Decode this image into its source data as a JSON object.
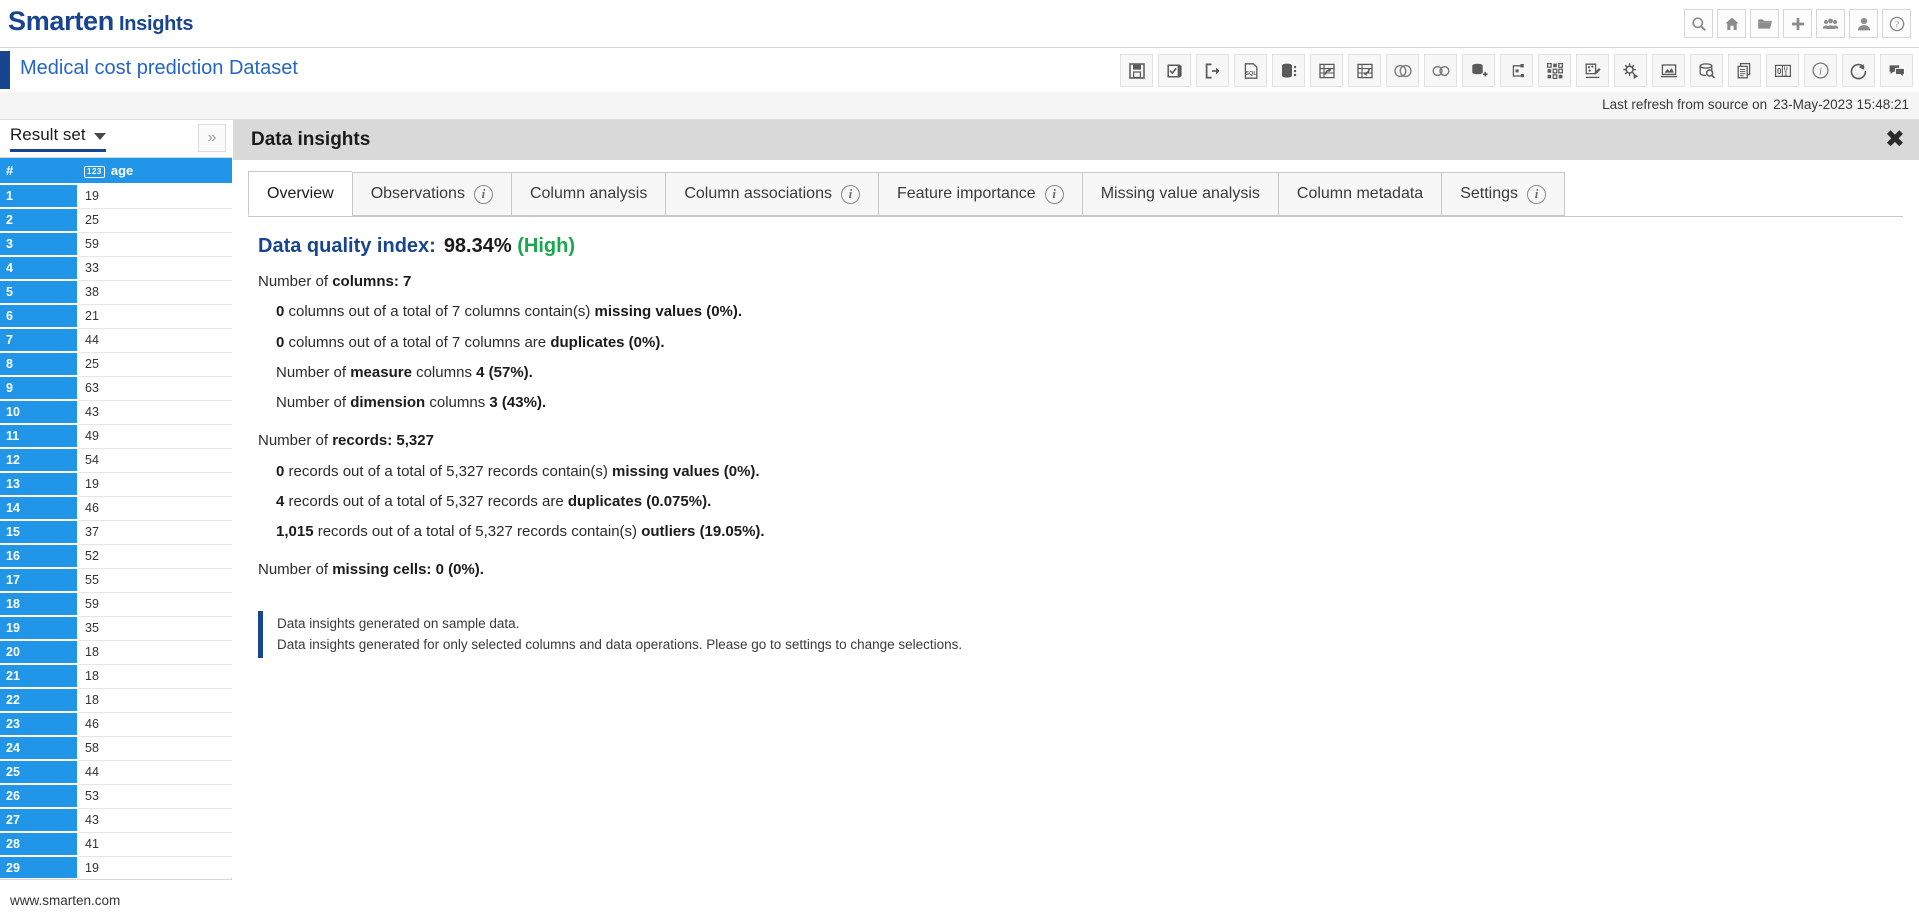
{
  "app": {
    "brand_name": "Smarten",
    "brand_suffix": "Insights",
    "accent_blue": "#17458f",
    "grid_blue": "#2196e8",
    "high_green": "#1aa84f"
  },
  "topbar": {
    "icons": [
      {
        "name": "search-icon",
        "label": "Search"
      },
      {
        "name": "home-icon",
        "label": "Home"
      },
      {
        "name": "folder-icon",
        "label": "Open"
      },
      {
        "name": "plus-icon",
        "label": "New"
      },
      {
        "name": "group-icon",
        "label": "Groups"
      },
      {
        "name": "user-icon",
        "label": "User"
      },
      {
        "name": "help-icon",
        "label": "Help"
      }
    ]
  },
  "titlebar": {
    "document_title": "Medical cost prediction Dataset",
    "toolbar_icons": [
      {
        "name": "save-icon",
        "label": "Save"
      },
      {
        "name": "validate-icon",
        "label": "Validate"
      },
      {
        "name": "export-icon",
        "label": "Export"
      },
      {
        "name": "sql-document-icon",
        "label": "SQL"
      },
      {
        "name": "database-list-icon",
        "label": "Data sources"
      },
      {
        "name": "table-export-icon",
        "label": "Table out"
      },
      {
        "name": "table-refresh-icon",
        "label": "Table refresh"
      },
      {
        "name": "union-icon",
        "label": "Union"
      },
      {
        "name": "join-icon",
        "label": "Join"
      },
      {
        "name": "database-add-icon",
        "label": "Add data"
      },
      {
        "name": "hierarchy-icon",
        "label": "Hierarchy"
      },
      {
        "name": "grid-squares-icon",
        "label": "Cube"
      },
      {
        "name": "palette-edit-icon",
        "label": "Theme"
      },
      {
        "name": "settings-run-icon",
        "label": "Process"
      },
      {
        "name": "presentation-icon",
        "label": "Presentation"
      },
      {
        "name": "database-search-icon",
        "label": "Data insights"
      },
      {
        "name": "copy-document-icon",
        "label": "Copy"
      },
      {
        "name": "binary-icon",
        "label": "Binary"
      },
      {
        "name": "info-circle-icon",
        "label": "Info"
      },
      {
        "name": "share-icon",
        "label": "Share"
      },
      {
        "name": "comment-icon",
        "label": "Comments"
      }
    ]
  },
  "refresh": {
    "label": "Last refresh from source on",
    "timestamp": "23-May-2023 15:48:21"
  },
  "left_panel": {
    "result_set_label": "Result set",
    "expand_icon": "chevron-double-right-icon",
    "footer_link": "www.smarten.com",
    "grid": {
      "columns": [
        {
          "key": "idx",
          "header": "#",
          "type_badge": ""
        },
        {
          "key": "age",
          "header": "age",
          "type_badge": "123"
        }
      ],
      "rows": [
        {
          "idx": "1",
          "age": "19"
        },
        {
          "idx": "2",
          "age": "25"
        },
        {
          "idx": "3",
          "age": "59"
        },
        {
          "idx": "4",
          "age": "33"
        },
        {
          "idx": "5",
          "age": "38"
        },
        {
          "idx": "6",
          "age": "21"
        },
        {
          "idx": "7",
          "age": "44"
        },
        {
          "idx": "8",
          "age": "25"
        },
        {
          "idx": "9",
          "age": "63"
        },
        {
          "idx": "10",
          "age": "43"
        },
        {
          "idx": "11",
          "age": "49"
        },
        {
          "idx": "12",
          "age": "54"
        },
        {
          "idx": "13",
          "age": "19"
        },
        {
          "idx": "14",
          "age": "46"
        },
        {
          "idx": "15",
          "age": "37"
        },
        {
          "idx": "16",
          "age": "52"
        },
        {
          "idx": "17",
          "age": "55"
        },
        {
          "idx": "18",
          "age": "59"
        },
        {
          "idx": "19",
          "age": "35"
        },
        {
          "idx": "20",
          "age": "18"
        },
        {
          "idx": "21",
          "age": "18"
        },
        {
          "idx": "22",
          "age": "18"
        },
        {
          "idx": "23",
          "age": "46"
        },
        {
          "idx": "24",
          "age": "58"
        },
        {
          "idx": "25",
          "age": "44"
        },
        {
          "idx": "26",
          "age": "53"
        },
        {
          "idx": "27",
          "age": "43"
        },
        {
          "idx": "28",
          "age": "41"
        },
        {
          "idx": "29",
          "age": "19"
        }
      ]
    }
  },
  "insights": {
    "panel_title": "Data insights",
    "close_icon": "close-icon",
    "tabs": [
      {
        "label": "Overview",
        "has_info": false,
        "active": true
      },
      {
        "label": "Observations",
        "has_info": true,
        "active": false
      },
      {
        "label": "Column analysis",
        "has_info": false,
        "active": false
      },
      {
        "label": "Column associations",
        "has_info": true,
        "active": false
      },
      {
        "label": "Feature importance",
        "has_info": true,
        "active": false
      },
      {
        "label": "Missing value analysis",
        "has_info": false,
        "active": false
      },
      {
        "label": "Column metadata",
        "has_info": false,
        "active": false
      },
      {
        "label": "Settings",
        "has_info": true,
        "active": false
      }
    ],
    "overview": {
      "dqi_label": "Data quality index:",
      "dqi_value": "98.34%",
      "dqi_level": "(High)",
      "columns_heading_pre": "Number of ",
      "columns_heading_bold": "columns: 7",
      "columns_lines": [
        "0 columns out of a total of 7 columns contain(s) missing values (0%).",
        "0 columns out of a total of 7 columns are duplicates (0%).",
        "Number of measure columns 4 (57%).",
        "Number of dimension columns 3 (43%)."
      ],
      "records_heading_pre": "Number of ",
      "records_heading_bold": "records: 5,327",
      "records_lines": [
        "0 records out of a total of 5,327 records contain(s) missing values (0%).",
        "4 records out of a total of 5,327 records are duplicates (0.075%).",
        "1,015 records out of a total of 5,327 records contain(s) outliers (19.05%)."
      ],
      "missing_cells_pre": "Number of ",
      "missing_cells_bold": "missing cells: 0 (0%).",
      "notes": [
        "Data insights generated on sample data.",
        "Data insights generated for only selected columns and data operations. Please go to settings to change selections."
      ]
    }
  }
}
